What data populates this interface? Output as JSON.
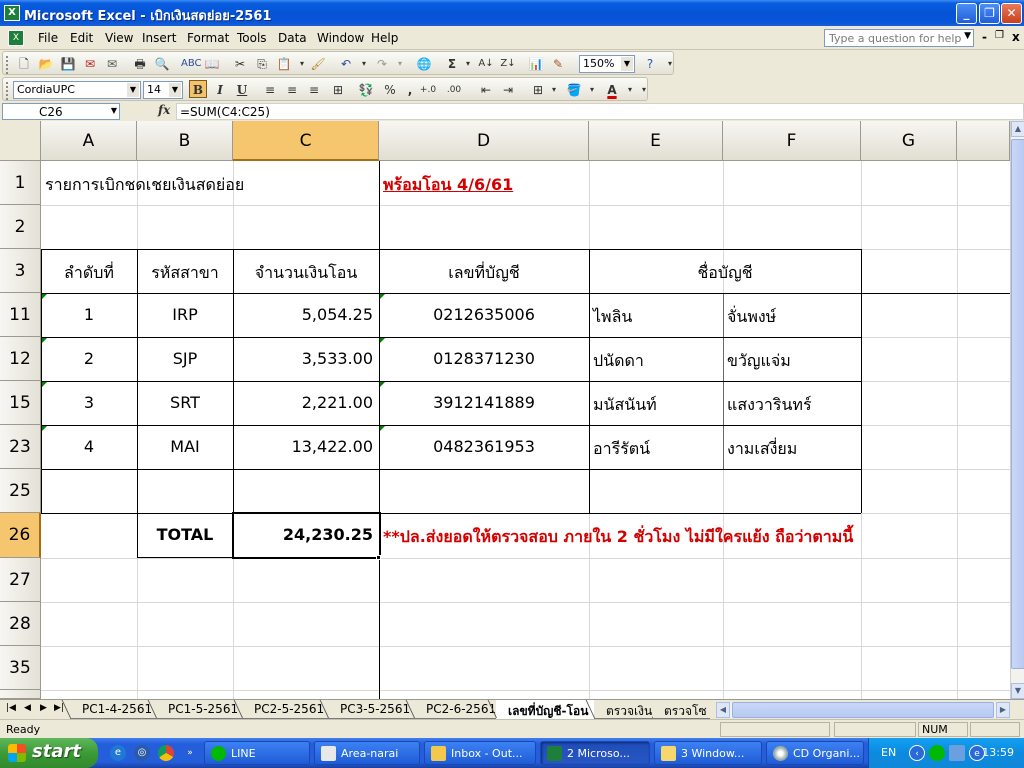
{
  "window": {
    "title": "Microsoft Excel - เบิกเงินสดย่อย-2561",
    "app_icon": "excel-icon",
    "minimize": "_",
    "restore": "❐",
    "close": "✕"
  },
  "menu": {
    "items": [
      "File",
      "Edit",
      "View",
      "Insert",
      "Format",
      "Tools",
      "Data",
      "Window",
      "Help"
    ],
    "help_placeholder": "Type a question for help",
    "doc_min": "-",
    "doc_restore": "❐",
    "doc_close": "x"
  },
  "toolbar": {
    "zoom": "150%",
    "sum_glyph": "Σ",
    "font_name": "CordiaUPC",
    "font_size": "14",
    "bold": "B",
    "italic": "I",
    "underline": "U",
    "percent": "%",
    "comma": ",",
    "inc_decimal": "+.0",
    "dec_decimal": ".00",
    "font_color_glyph": "A"
  },
  "formula_bar": {
    "name_box": "C26",
    "fx_label": "fx",
    "formula": "=SUM(C4:C25)"
  },
  "grid": {
    "columns": [
      "A",
      "B",
      "C",
      "D",
      "E",
      "F",
      "G"
    ],
    "active_column": "C",
    "rows": [
      "1",
      "2",
      "3",
      "11",
      "12",
      "15",
      "23",
      "25",
      "26",
      "27",
      "28",
      "35"
    ],
    "active_row": "26",
    "cells": {
      "title": "รายการเบิกชดเชยเงินสดย่อย",
      "ready_note": "พร้อมโอน  4/6/61",
      "hdr_seq": "ลำดับที่",
      "hdr_branch": "รหัสสาขา",
      "hdr_amount": "จำนวนเงินโอน",
      "hdr_account": "เลขที่บัญชี",
      "hdr_name": "ชื่อบัญชี",
      "total_label": "TOTAL",
      "total_value": "24,230.25",
      "footnote": "**ปล.ส่งยอดให้ตรวจสอบ ภายใน 2 ชั่วโมง ไม่มีใครแย้ง ถือว่าตามนี้"
    },
    "records": [
      {
        "seq": "1",
        "branch": "IRP",
        "amount": "5,054.25",
        "account": "0212635006",
        "first": "ไพลิน",
        "last": "จั่นพงษ์"
      },
      {
        "seq": "2",
        "branch": "SJP",
        "amount": "3,533.00",
        "account": "0128371230",
        "first": "ปนัดดา",
        "last": "ขวัญแจ่ม"
      },
      {
        "seq": "3",
        "branch": "SRT",
        "amount": "2,221.00",
        "account": "3912141889",
        "first": "มนัสนันท์",
        "last": "แสงวารินทร์"
      },
      {
        "seq": "4",
        "branch": "MAI",
        "amount": "13,422.00",
        "account": "0482361953",
        "first": "อารีรัตน์",
        "last": "งามเสงี่ยม"
      }
    ]
  },
  "sheet_tabs": {
    "tabs": [
      "PC1-4-2561",
      "PC1-5-2561",
      "PC2-5-2561",
      "PC3-5-2561",
      "PC2-6-2561",
      "เลขที่บัญชี-โอน",
      "ตรวจเงิน",
      "ตรวจโซ"
    ],
    "active": "เลขที่บัญชี-โอน"
  },
  "status": {
    "ready": "Ready",
    "num": "NUM"
  },
  "taskbar": {
    "start": "start",
    "tasks": [
      "LINE",
      "Area-narai",
      "Inbox - Out...",
      "2 Microso...",
      "3 Window...",
      "CD Organi..."
    ],
    "active_task": "2 Microso...",
    "lang": "EN",
    "clock": "13:59"
  },
  "colors": {
    "accent_red": "#d40000",
    "active_header": "#f6c66e",
    "titlebar_blue": "#0453d6"
  }
}
